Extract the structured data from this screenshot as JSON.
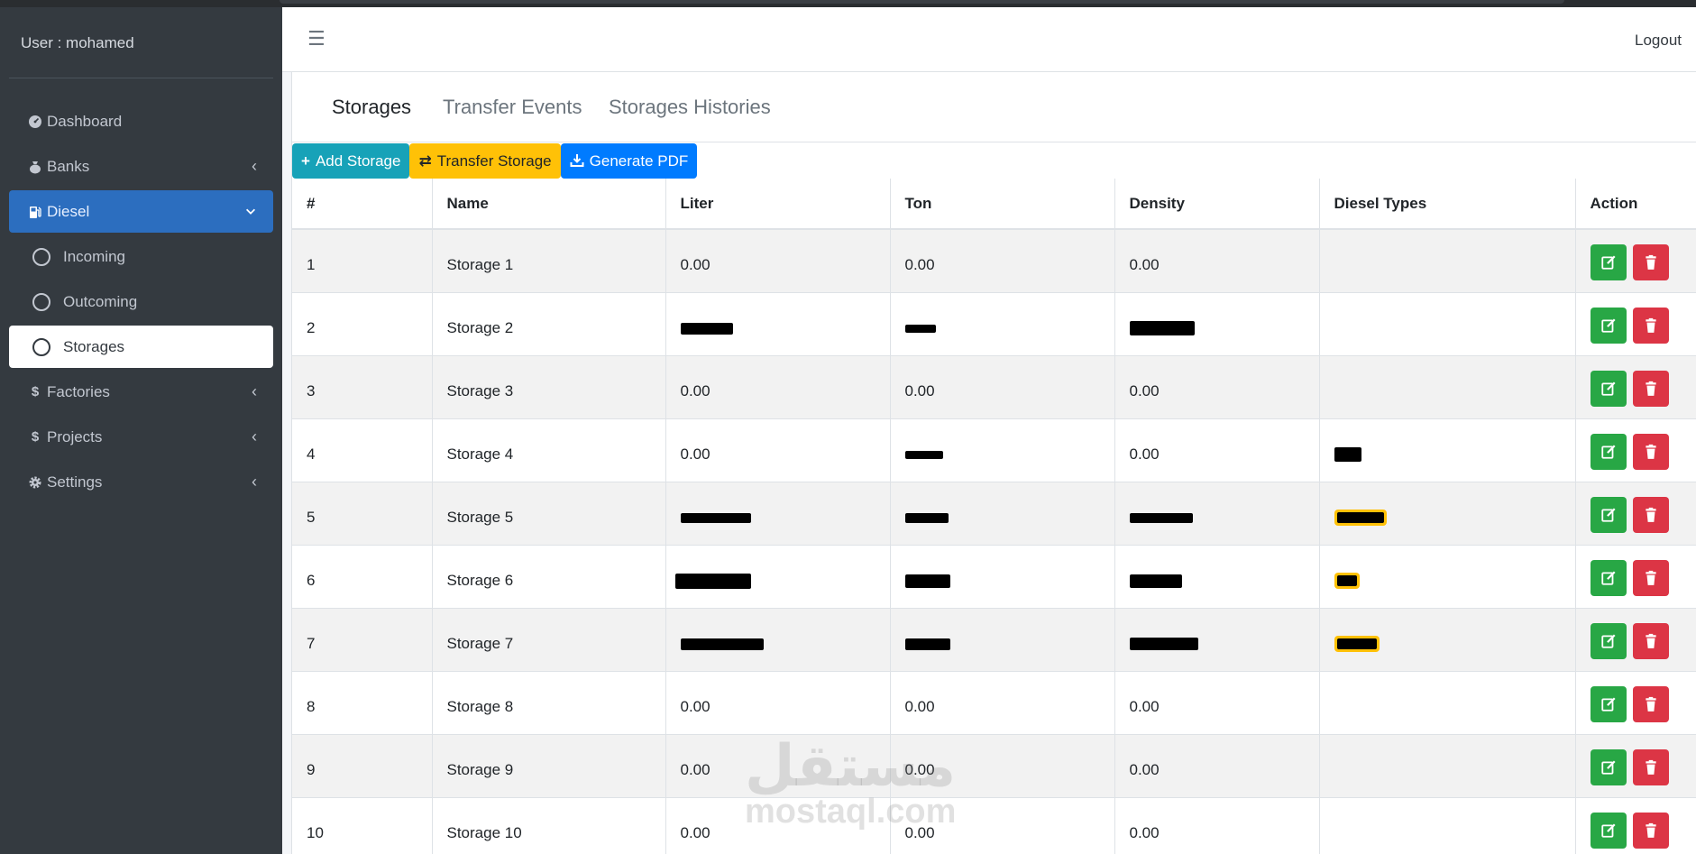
{
  "user_label": "User : mohamed",
  "sidebar": {
    "items": [
      {
        "label": "Dashboard",
        "icon": "tachometer-icon",
        "chev": false
      },
      {
        "label": "Banks",
        "icon": "money-bag-icon",
        "chev": true
      },
      {
        "label": "Diesel",
        "icon": "gas-pump-icon",
        "chev": true,
        "active": true
      },
      {
        "label": "Incoming",
        "sub": true
      },
      {
        "label": "Outcoming",
        "sub": true
      },
      {
        "label": "Storages",
        "sub": true,
        "selected": true
      },
      {
        "label": "Factories",
        "icon": "dollar-icon",
        "chev": true
      },
      {
        "label": "Projects",
        "icon": "dollar-icon",
        "chev": true
      },
      {
        "label": "Settings",
        "icon": "gear-icon",
        "chev": true
      }
    ]
  },
  "header": {
    "logout": "Logout"
  },
  "tabs": [
    {
      "label": "Storages",
      "active": true
    },
    {
      "label": "Transfer Events"
    },
    {
      "label": "Storages Histories"
    }
  ],
  "toolbar": {
    "add": "Add Storage",
    "transfer": "Transfer Storage",
    "pdf": "Generate PDF"
  },
  "table": {
    "columns": [
      "#",
      "Name",
      "Liter",
      "Ton",
      "Density",
      "Diesel Types",
      "Action"
    ],
    "rows": [
      {
        "num": "1",
        "name": "Storage 1",
        "liter": "0.00",
        "ton": "0.00",
        "density": "0.00"
      },
      {
        "num": "2",
        "name": "Storage 2",
        "liter": "",
        "ton": "",
        "density": ""
      },
      {
        "num": "3",
        "name": "Storage 3",
        "liter": "0.00",
        "ton": "0.00",
        "density": "0.00"
      },
      {
        "num": "4",
        "name": "Storage 4",
        "liter": "0.00",
        "ton": "",
        "density": "0.00"
      },
      {
        "num": "5",
        "name": "Storage 5",
        "liter": "",
        "ton": "",
        "density": ""
      },
      {
        "num": "6",
        "name": "Storage 6",
        "liter": "",
        "ton": "",
        "density": ""
      },
      {
        "num": "7",
        "name": "Storage 7",
        "liter": "",
        "ton": "",
        "density": ""
      },
      {
        "num": "8",
        "name": "Storage 8",
        "liter": "0.00",
        "ton": "0.00",
        "density": "0.00"
      },
      {
        "num": "9",
        "name": "Storage 9",
        "liter": "0.00",
        "ton": "0.00",
        "density": "0.00"
      },
      {
        "num": "10",
        "name": "Storage 10",
        "liter": "0.00",
        "ton": "0.00",
        "density": "0.00"
      }
    ]
  },
  "watermark": {
    "arabic": "مستقل",
    "latin": "mostaql.com"
  },
  "colors": {
    "sidebar_bg": "#343a40",
    "active_nav": "#2c6ebf",
    "btn_teal": "#17a2b8",
    "btn_yellow": "#ffc107",
    "btn_blue": "#007bff",
    "edit_green": "#28a745",
    "delete_red": "#dc3545"
  }
}
